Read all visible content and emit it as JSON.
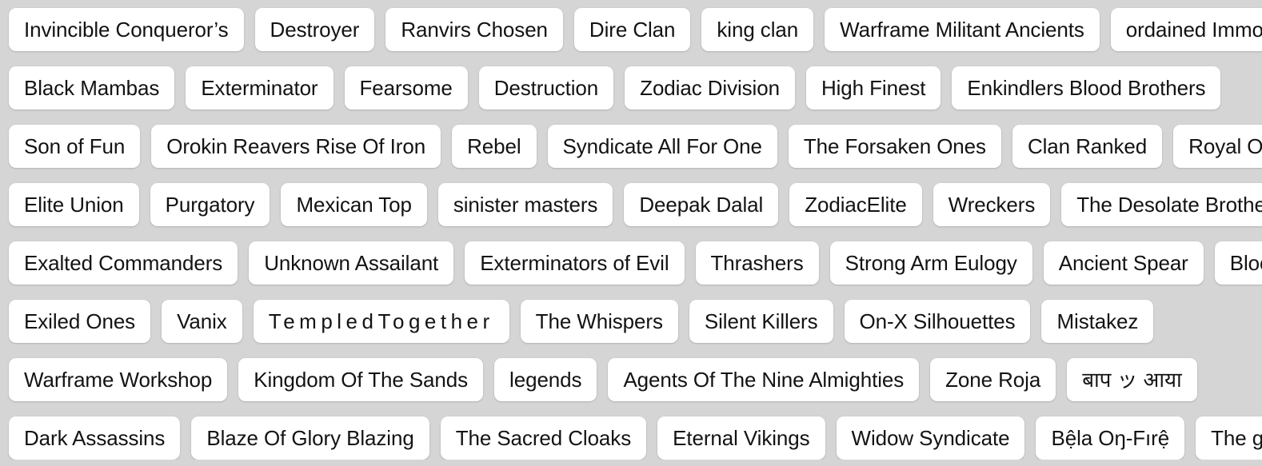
{
  "theme": {
    "background_color": "#d5d5d5",
    "chip_background_color": "#ffffff",
    "chip_text_color": "#131313"
  },
  "tag_cloud": {
    "rows": [
      {
        "chips": [
          {
            "label": "Invincible Conqueror’s"
          },
          {
            "label": "Destroyer"
          },
          {
            "label": "Ranvirs Chosen"
          },
          {
            "label": "Dire Clan"
          },
          {
            "label": "king clan"
          },
          {
            "label": "Warframe Militant Ancients"
          },
          {
            "label": "ordained Immortal"
          }
        ]
      },
      {
        "chips": [
          {
            "label": "Black Mambas"
          },
          {
            "label": "Exterminator"
          },
          {
            "label": "Fearsome"
          },
          {
            "label": "Destruction"
          },
          {
            "label": "Zodiac Division"
          },
          {
            "label": "High Finest"
          },
          {
            "label": "Enkindlers Blood Brothers"
          }
        ]
      },
      {
        "chips": [
          {
            "label": "Son of Fun"
          },
          {
            "label": "Orokin Reavers Rise Of Iron"
          },
          {
            "label": "Rebel"
          },
          {
            "label": "Syndicate All For One"
          },
          {
            "label": "The Forsaken Ones"
          },
          {
            "label": "Clan Ranked"
          },
          {
            "label": "Royal Officer"
          }
        ]
      },
      {
        "chips": [
          {
            "label": "Elite Union"
          },
          {
            "label": "Purgatory"
          },
          {
            "label": "Mexican Top"
          },
          {
            "label": "sinister masters"
          },
          {
            "label": "Deepak Dalal"
          },
          {
            "label": "ZodiacElite"
          },
          {
            "label": "Wreckers"
          },
          {
            "label": "The Desolate Brotherhood"
          }
        ]
      },
      {
        "chips": [
          {
            "label": "Exalted Commanders"
          },
          {
            "label": "Unknown Assailant"
          },
          {
            "label": "Exterminators of Evil"
          },
          {
            "label": "Thrashers"
          },
          {
            "label": "Strong Arm Eulogy"
          },
          {
            "label": "Ancient Spear"
          },
          {
            "label": "Bloods"
          }
        ]
      },
      {
        "chips": [
          {
            "label": "Exiled Ones"
          },
          {
            "label": "Vanix"
          },
          {
            "label": "TempledTogether",
            "spaced": true
          },
          {
            "label": "The Whispers"
          },
          {
            "label": "Silent Killers"
          },
          {
            "label": "On-X Silhouettes"
          },
          {
            "label": "Mistakez"
          }
        ]
      },
      {
        "chips": [
          {
            "label": "Warframe Workshop"
          },
          {
            "label": "Kingdom Of The Sands"
          },
          {
            "label": "legends"
          },
          {
            "label": "Agents Of The Nine Almighties"
          },
          {
            "label": "Zone Roja"
          },
          {
            "label": "बाप ッ आया"
          }
        ]
      },
      {
        "chips": [
          {
            "label": "Dark Assassins"
          },
          {
            "label": "Blaze Of Glory Blazing"
          },
          {
            "label": "The Sacred Cloaks"
          },
          {
            "label": "Eternal Vikings"
          },
          {
            "label": "Widow Syndicate"
          },
          {
            "label": "Bệla Oŋ-Fırệ"
          },
          {
            "label": "The grave"
          }
        ]
      }
    ]
  }
}
